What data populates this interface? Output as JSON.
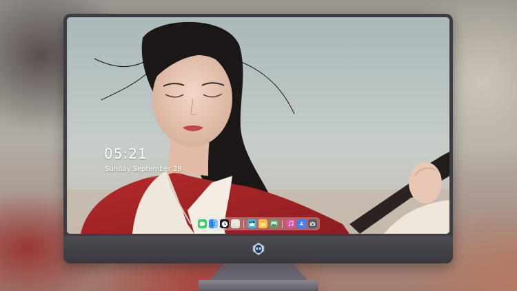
{
  "lock_screen": {
    "time": "05:21",
    "date": "Sunday September  28",
    "quote": "······ ···· ·········· ·· ······ ·· ···· ······· ·········· ·· ········ ···"
  },
  "dock": {
    "apps": [
      {
        "name": "messages",
        "icon": "message-bubble-icon",
        "color": "#3ccf5a"
      },
      {
        "name": "finder",
        "icon": "finder-icon",
        "color": "#2d8cf0"
      },
      {
        "name": "clock",
        "icon": "clock-icon",
        "color": "#1c1c1e"
      },
      {
        "name": "notes",
        "icon": "notes-icon",
        "color": "#e9e4d6"
      },
      {
        "name": "claquette",
        "icon": "clapperboard-icon",
        "color": "#39b7d6"
      },
      {
        "name": "stickies",
        "icon": "stickies-icon",
        "color": "#f6c244"
      },
      {
        "name": "photos",
        "icon": "photos-icon",
        "color": "#6a9f5b"
      },
      {
        "name": "music",
        "icon": "music-note-icon",
        "color": "#e94aa6"
      },
      {
        "name": "app-store",
        "icon": "app-store-icon",
        "color": "#3b82f6"
      },
      {
        "name": "screenshot",
        "icon": "camera-icon",
        "color": "#5b5b63"
      }
    ]
  },
  "monitor": {
    "frame_color": "#3f3d44",
    "logo_icon": "alien-head-logo-icon"
  }
}
